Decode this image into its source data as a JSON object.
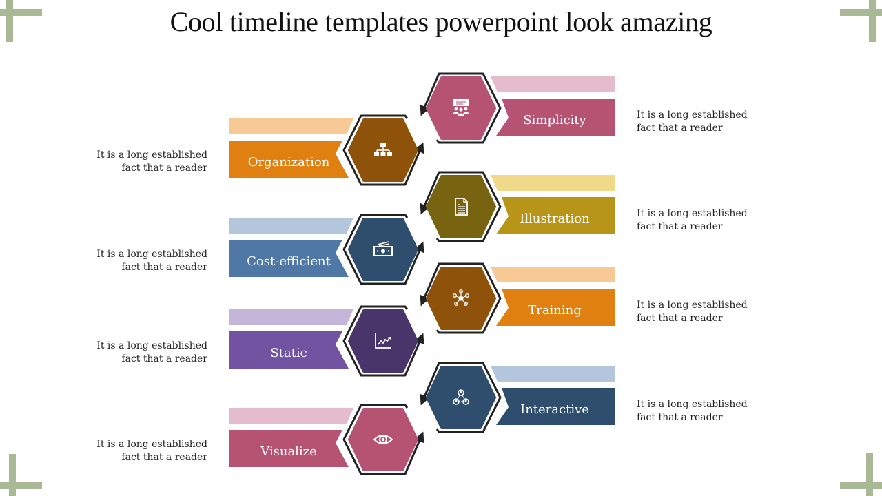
{
  "title": "Cool timeline templates powerpoint look amazing",
  "corner_color": "#a9b995",
  "left_steps": [
    {
      "label": "Organization",
      "icon": "org-chart-icon",
      "hex_color": "#8e520b",
      "band_color": "#df8011",
      "light_color": "#f6c995",
      "desc_line1": "It is a long established",
      "desc_line2": "fact that a reader"
    },
    {
      "label": "Cost-efficient",
      "icon": "money-icon",
      "hex_color": "#2f4e6e",
      "band_color": "#4f78a6",
      "light_color": "#b3c6dc",
      "desc_line1": "It is a long established",
      "desc_line2": "fact that a reader"
    },
    {
      "label": "Static",
      "icon": "line-chart-icon",
      "hex_color": "#4a356b",
      "band_color": "#7153a2",
      "light_color": "#c4b6d8",
      "desc_line1": "It is a long established",
      "desc_line2": "fact that a reader"
    },
    {
      "label": "Visualize",
      "icon": "eye-icon",
      "hex_color": "#b65373",
      "band_color": "#b65373",
      "light_color": "#e4bccb",
      "desc_line1": "It is a long established",
      "desc_line2": "fact that a reader"
    }
  ],
  "right_steps": [
    {
      "label": "Simplicity",
      "icon": "presentation-audience-icon",
      "hex_color": "#b65373",
      "band_color": "#b65373",
      "light_color": "#e4bccb",
      "desc_line1": "It is a long established",
      "desc_line2": "fact that a reader"
    },
    {
      "label": "Illustration",
      "icon": "document-icon",
      "hex_color": "#786311",
      "band_color": "#b79519",
      "light_color": "#f1d98a",
      "desc_line1": "It is a long established",
      "desc_line2": "fact that a reader"
    },
    {
      "label": "Training",
      "icon": "network-hub-icon",
      "hex_color": "#8e520b",
      "band_color": "#df8011",
      "light_color": "#f6c995",
      "desc_line1": "It is a long established",
      "desc_line2": "fact that a reader"
    },
    {
      "label": "Interactive",
      "icon": "team-network-icon",
      "hex_color": "#2f4e6e",
      "band_color": "#2f4e6e",
      "light_color": "#b3c6dc",
      "desc_line1": "It is a long established",
      "desc_line2": "fact that a reader"
    }
  ]
}
